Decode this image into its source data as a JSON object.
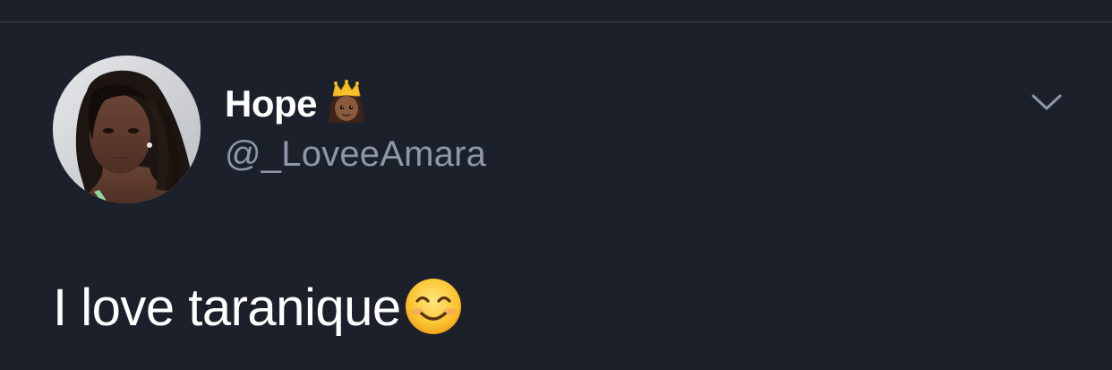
{
  "tweet": {
    "author": {
      "display_name": "Hope",
      "handle": "@_LoveeAmara",
      "name_emoji": "princess-emoji"
    },
    "text": "I love taranique",
    "text_emoji": "smiling-face-emoji",
    "menu_icon": "chevron-down-icon"
  },
  "colors": {
    "background": "#1b202b",
    "divider": "#3a4250",
    "primary_text": "#ffffff",
    "secondary_text": "#8b98a8"
  }
}
